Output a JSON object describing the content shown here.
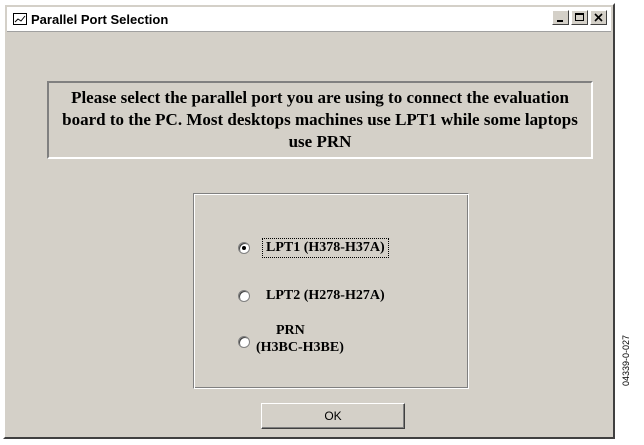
{
  "window": {
    "title": "Parallel Port Selection",
    "icon": "app-window-icon",
    "controls": [
      "minimize-icon",
      "maximize-icon",
      "close-icon"
    ]
  },
  "message": "Please select the parallel port you are using to connect the evaluation board to the PC. Most desktops machines use LPT1 while some laptops use PRN",
  "ports": [
    {
      "label": "LPT1 (H378-H37A)",
      "selected": true
    },
    {
      "label": "LPT2 (H278-H27A)",
      "selected": false
    },
    {
      "label_line1": "PRN",
      "label_line2": "(H3BC-H3BE)",
      "selected": false
    }
  ],
  "ok_label": "OK",
  "figure_code": "04339-0-027",
  "colors": {
    "face": "#d4d0c8",
    "shadow": "#808080",
    "highlight": "#ffffff"
  }
}
